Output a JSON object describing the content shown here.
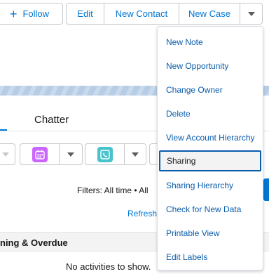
{
  "header": {
    "follow_label": "Follow",
    "actions": [
      "Edit",
      "New Contact",
      "New Case"
    ]
  },
  "tabs": {
    "chatter_label": "Chatter"
  },
  "activity": {
    "filters_text": "Filters: All time • All",
    "refresh_label": "Refresh",
    "section_title": "ning & Overdue",
    "empty_text": "No activities to show."
  },
  "menu": {
    "items": [
      "New Note",
      "New Opportunity",
      "Change Owner",
      "Delete",
      "View Account Hierarchy",
      "Sharing",
      "Sharing Hierarchy",
      "Check for New Data",
      "Printable View",
      "Edit Labels"
    ],
    "selected_item": "Sharing"
  },
  "colors": {
    "brand_blue": "#0176d3",
    "event_icon": "#cb65ff",
    "call_icon": "#48c3cc"
  },
  "icons": [
    "plus-icon",
    "chevron-down-icon",
    "calendar-icon",
    "phone-icon"
  ]
}
